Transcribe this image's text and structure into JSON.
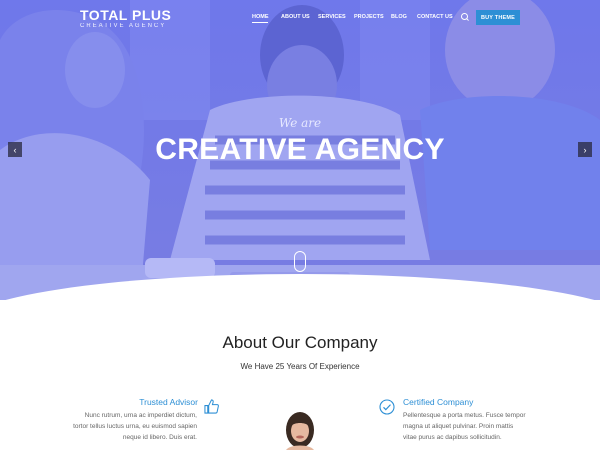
{
  "brand": {
    "name": "TOTAL PLUS",
    "tagline": "CREATIVE AGENCY",
    "accent_color": "#2d8fd5",
    "hero_tint": "#6f78e8"
  },
  "nav": {
    "items": [
      "HOME",
      "ABOUT US",
      "SERVICES",
      "PROJECTS",
      "BLOG",
      "CONTACT US"
    ],
    "active": "HOME",
    "search_icon": "search-icon",
    "cta_label": "BUY THEME"
  },
  "hero": {
    "kicker": "We are",
    "title": "CREATIVE AGENCY",
    "prev_icon": "chevron-left-icon",
    "next_icon": "chevron-right-icon",
    "scroll_icon": "mouse-scroll-icon"
  },
  "about": {
    "title": "About Our Company",
    "subtitle": "We Have 25 Years Of Experience",
    "features": [
      {
        "title": "Trusted Advisor",
        "icon": "thumbs-up-icon",
        "lines": [
          "Nunc rutrum, urna ac imperdiet dictum,",
          "tortor tellus luctus urna, eu euismod sapien",
          "neque id libero. Duis erat."
        ]
      },
      {
        "title": "Certified Company",
        "icon": "check-circle-icon",
        "lines": [
          "Pellentesque a porta metus. Fusce tempor",
          "magna ut aliquet pulvinar. Proin mattis",
          "vitae purus ac dapibus sollicitudin."
        ]
      }
    ]
  }
}
